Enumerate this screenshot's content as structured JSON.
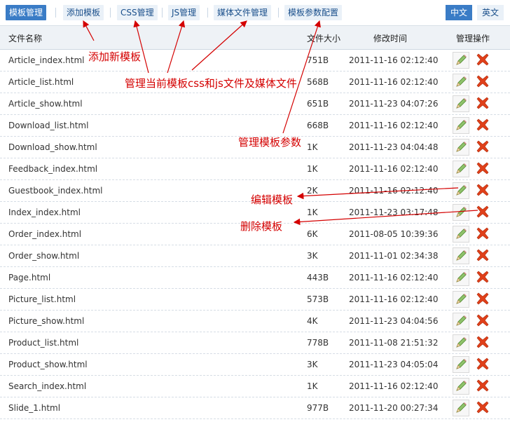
{
  "toolbar": {
    "tabs": [
      {
        "label": "模板管理",
        "active": true
      },
      {
        "label": "添加模板",
        "active": false
      },
      {
        "label": "CSS管理",
        "active": false
      },
      {
        "label": "JS管理",
        "active": false
      },
      {
        "label": "媒体文件管理",
        "active": false
      },
      {
        "label": "模板参数配置",
        "active": false
      }
    ],
    "lang": [
      {
        "label": "中文",
        "active": true
      },
      {
        "label": "英文",
        "active": false
      }
    ]
  },
  "table": {
    "headers": {
      "name": "文件名称",
      "size": "文件大小",
      "time": "修改时间",
      "ops": "管理操作"
    },
    "rows": [
      {
        "name": "Article_index.html",
        "size": "751B",
        "time": "2011-11-16 02:12:40"
      },
      {
        "name": "Article_list.html",
        "size": "568B",
        "time": "2011-11-16 02:12:40"
      },
      {
        "name": "Article_show.html",
        "size": "651B",
        "time": "2011-11-23 04:07:26"
      },
      {
        "name": "Download_list.html",
        "size": "668B",
        "time": "2011-11-16 02:12:40"
      },
      {
        "name": "Download_show.html",
        "size": "1K",
        "time": "2011-11-23 04:04:48"
      },
      {
        "name": "Feedback_index.html",
        "size": "1K",
        "time": "2011-11-16 02:12:40"
      },
      {
        "name": "Guestbook_index.html",
        "size": "2K",
        "time": "2011-11-16 02:12:40"
      },
      {
        "name": "Index_index.html",
        "size": "1K",
        "time": "2011-11-23 03:17:48"
      },
      {
        "name": "Order_index.html",
        "size": "6K",
        "time": "2011-08-05 10:39:36"
      },
      {
        "name": "Order_show.html",
        "size": "3K",
        "time": "2011-11-01 02:34:38"
      },
      {
        "name": "Page.html",
        "size": "443B",
        "time": "2011-11-16 02:12:40"
      },
      {
        "name": "Picture_list.html",
        "size": "573B",
        "time": "2011-11-16 02:12:40"
      },
      {
        "name": "Picture_show.html",
        "size": "4K",
        "time": "2011-11-23 04:04:56"
      },
      {
        "name": "Product_list.html",
        "size": "778B",
        "time": "2011-11-08 21:51:32"
      },
      {
        "name": "Product_show.html",
        "size": "3K",
        "time": "2011-11-23 04:05:04"
      },
      {
        "name": "Search_index.html",
        "size": "1K",
        "time": "2011-11-16 02:12:40"
      },
      {
        "name": "Slide_1.html",
        "size": "977B",
        "time": "2011-11-20 00:27:34"
      }
    ]
  },
  "annotations": {
    "add": "添加新模板",
    "manage": "管理当前模板css和js文件及媒体文件",
    "params": "管理模板参数",
    "edit": "编辑模板",
    "delete": "删除模板"
  },
  "colors": {
    "accent": "#3a7cc6",
    "annotation": "#d40000",
    "delete": "#e0401a",
    "edit": "#6aa84f"
  },
  "icons": {
    "edit": "pencil-icon",
    "delete": "delete-x-icon"
  }
}
